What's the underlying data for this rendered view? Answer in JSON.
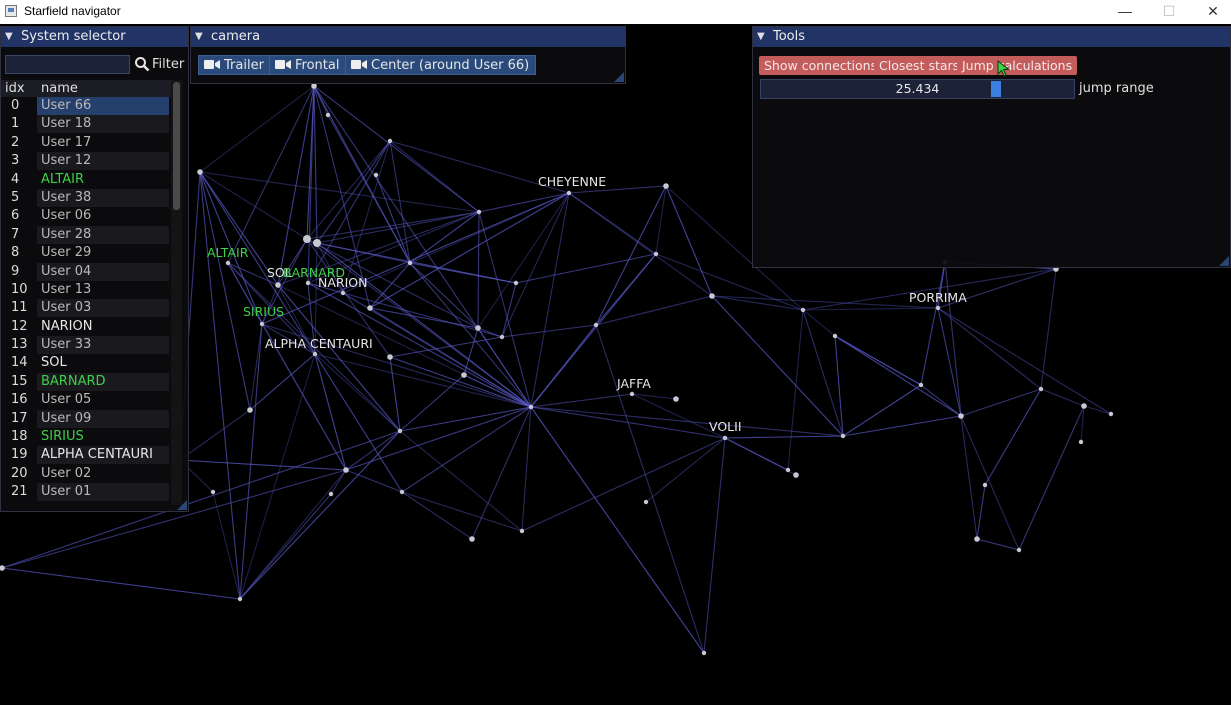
{
  "window": {
    "title": "Starfield navigator",
    "minimize": "—",
    "maximize": "☐",
    "close": "✕"
  },
  "map_labels": [
    {
      "id": "cheyenne",
      "text": "CHEYENNE",
      "color": "#e6e6e6"
    },
    {
      "id": "altair",
      "text": "ALTAIR",
      "color": "#3fd04a"
    },
    {
      "id": "sol",
      "text": "SOL",
      "color": "#e6e6e6"
    },
    {
      "id": "barnard",
      "text": "BARNARD",
      "color": "#3fd04a"
    },
    {
      "id": "narion",
      "text": "NARION",
      "color": "#e6e6e6"
    },
    {
      "id": "sirius",
      "text": "SIRIUS",
      "color": "#3fd04a"
    },
    {
      "id": "alpha-centauri",
      "text": "ALPHA CENTAURI",
      "color": "#e6e6e6"
    },
    {
      "id": "porrima",
      "text": "PORRIMA",
      "color": "#e6e6e6"
    },
    {
      "id": "jaffa",
      "text": "JAFFA",
      "color": "#e6e6e6"
    },
    {
      "id": "volii",
      "text": "VOLII",
      "color": "#e6e6e6"
    }
  ],
  "system_selector": {
    "title": "System selector",
    "filter_value": "",
    "filter_label": "Filter",
    "columns": [
      "idx",
      "name"
    ],
    "rows": [
      {
        "idx": "0",
        "name": "User 66"
      },
      {
        "idx": "1",
        "name": "User 18"
      },
      {
        "idx": "2",
        "name": "User 17"
      },
      {
        "idx": "3",
        "name": "User 12"
      },
      {
        "idx": "4",
        "name": "ALTAIR"
      },
      {
        "idx": "5",
        "name": "User 38"
      },
      {
        "idx": "6",
        "name": "User 06"
      },
      {
        "idx": "7",
        "name": "User 28"
      },
      {
        "idx": "8",
        "name": "User 29"
      },
      {
        "idx": "9",
        "name": "User 04"
      },
      {
        "idx": "10",
        "name": "User 13"
      },
      {
        "idx": "11",
        "name": "User 03"
      },
      {
        "idx": "12",
        "name": "NARION"
      },
      {
        "idx": "13",
        "name": "User 33"
      },
      {
        "idx": "14",
        "name": "SOL"
      },
      {
        "idx": "15",
        "name": "BARNARD"
      },
      {
        "idx": "16",
        "name": "User 05"
      },
      {
        "idx": "17",
        "name": "User 09"
      },
      {
        "idx": "18",
        "name": "SIRIUS"
      },
      {
        "idx": "19",
        "name": "ALPHA CENTAURI"
      },
      {
        "idx": "20",
        "name": "User 02"
      },
      {
        "idx": "21",
        "name": "User 01"
      }
    ]
  },
  "camera": {
    "title": "camera",
    "buttons": [
      "Trailer",
      "Frontal",
      "Center (around User 66)"
    ]
  },
  "tools": {
    "title": "Tools",
    "buttons": [
      "Show connections",
      "Closest stars",
      "Jump calculations"
    ],
    "jump_range_value": "25.434",
    "jump_range_label": "jump range",
    "jump_range_fraction": 0.75
  },
  "colors": {
    "header": "#223366",
    "selected_row": "#25406c",
    "green_label": "#3fd04a",
    "tool_button": "#c55c5c",
    "link": "#5a5acc"
  }
}
